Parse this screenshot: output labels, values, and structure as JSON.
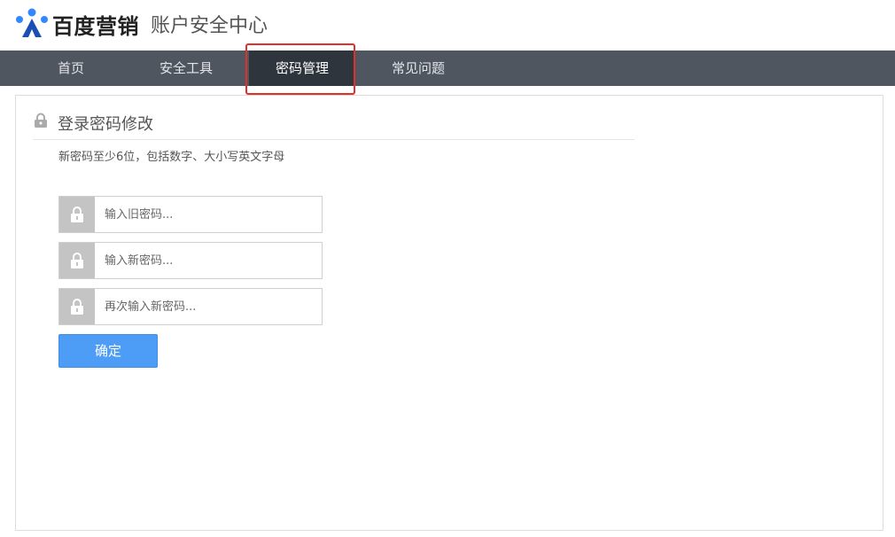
{
  "header": {
    "brand": "百度营销",
    "subtitle": "账户安全中心",
    "logo_icon": "baidu-marketing-logo",
    "colors": {
      "logo_blue": "#3388ff",
      "logo_dark": "#1b4fb3"
    }
  },
  "nav": {
    "items": [
      {
        "label": "首页"
      },
      {
        "label": "安全工具"
      },
      {
        "label": "密码管理",
        "active": true
      },
      {
        "label": "常见问题"
      }
    ],
    "colors": {
      "bar": "#4f5660",
      "active": "#2f353d",
      "highlight_border": "#e0302c"
    }
  },
  "section": {
    "title": "登录密码修改",
    "icon": "lock-icon",
    "hint": "新密码至少6位，包括数字、大小写英文字母"
  },
  "form": {
    "old_password": {
      "placeholder": "输入旧密码...",
      "value": ""
    },
    "new_password": {
      "placeholder": "输入新密码...",
      "value": ""
    },
    "confirm_password": {
      "placeholder": "再次输入新密码...",
      "value": ""
    },
    "submit_label": "确定",
    "colors": {
      "button": "#4d9cf5",
      "lock_box": "#c4c4c4"
    }
  }
}
